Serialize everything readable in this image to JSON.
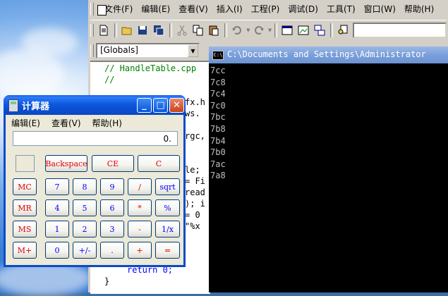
{
  "ide": {
    "menu": [
      "文件(F)",
      "编辑(E)",
      "查看(V)",
      "插入(I)",
      "工程(P)",
      "调试(D)",
      "工具(T)",
      "窗口(W)",
      "帮助(H)"
    ],
    "toolbar_icons": [
      "new-file-icon",
      "open-folder-icon",
      "save-icon",
      "save-all-icon",
      "cut-icon",
      "copy-icon",
      "paste-icon",
      "undo-icon",
      "redo-icon",
      "workspace-icon",
      "output-icon",
      "window-list-icon",
      "find-in-files-icon"
    ],
    "scope_combo": "[Globals]",
    "code": [
      "// HandleTable.cpp",
      "//",
      "fx.h",
      "ws.",
      "rgc,",
      "le;",
      "= Fi",
      "read",
      "); i",
      "= 0",
      "\"%x",
      "return 0;",
      "}"
    ]
  },
  "console": {
    "title": "C:\\Documents and Settings\\Administrator",
    "icon_text": "C:\\",
    "lines": [
      "7cc",
      "7c8",
      "7c4",
      "7c0",
      "7bc",
      "7b8",
      "7b4",
      "7b0",
      "7ac",
      "7a8"
    ]
  },
  "calculator": {
    "title": "计算器",
    "menu": [
      "编辑(E)",
      "查看(V)",
      "帮助(H)"
    ],
    "display": "0.",
    "window_buttons": {
      "minimize": "_",
      "maximize": "□",
      "close": "✕"
    },
    "buttons": {
      "backspace": "Backspace",
      "ce": "CE",
      "c": "C",
      "mc": "MC",
      "mr": "MR",
      "ms": "MS",
      "mplus": "M+",
      "seven": "7",
      "eight": "8",
      "nine": "9",
      "divide": "/",
      "sqrt": "sqrt",
      "four": "4",
      "five": "5",
      "six": "6",
      "multiply": "*",
      "percent": "%",
      "one": "1",
      "two": "2",
      "three": "3",
      "minus": "-",
      "reciprocal": "1/x",
      "zero": "0",
      "sign": "+/-",
      "dot": ".",
      "plus": "+",
      "equals": "="
    }
  }
}
